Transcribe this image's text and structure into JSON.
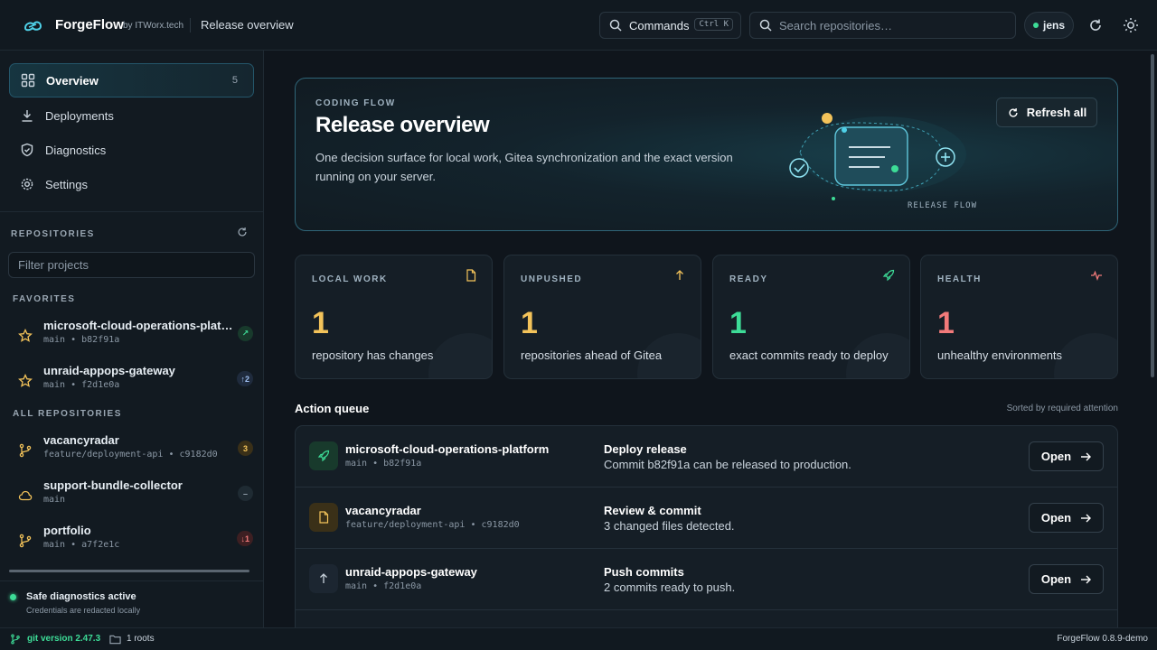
{
  "colors": {
    "accent": "#4fd1e8",
    "green": "#3ddc97",
    "yellow": "#f3c35a",
    "red": "#f27a7a",
    "blue": "#7aa7f2"
  },
  "topbar": {
    "brand": "ForgeFlow",
    "brand_by": "by ITWorx.tech",
    "page_title": "Release overview",
    "commands_label": "Commands",
    "commands_shortcut": "Ctrl K",
    "search_placeholder": "Search repositories…",
    "user": "jens"
  },
  "sidebar": {
    "nav": [
      {
        "label": "Overview",
        "count": "5",
        "icon": "grid-icon",
        "active": true
      },
      {
        "label": "Deployments",
        "icon": "download-icon"
      },
      {
        "label": "Diagnostics",
        "icon": "shield-icon"
      },
      {
        "label": "Settings",
        "icon": "gear-icon"
      }
    ],
    "repositories_label": "REPOSITORIES",
    "filter_placeholder": "Filter projects",
    "favorites_label": "FAVORITES",
    "all_label": "ALL REPOSITORIES",
    "favorites": [
      {
        "name": "microsoft-cloud-operations-platform",
        "meta": "main • b82f91a",
        "badge": "↗",
        "icon": "star-icon"
      },
      {
        "name": "unraid-appops-gateway",
        "meta": "main • f2d1e0a",
        "badge": "↑2",
        "icon": "star-icon"
      }
    ],
    "repos": [
      {
        "name": "vacancyradar",
        "meta": "feature/deployment-api • c9182d0",
        "badge": "3",
        "icon": "branch-icon"
      },
      {
        "name": "support-bundle-collector",
        "meta": "main",
        "badge": "–",
        "icon": "cloud-icon"
      },
      {
        "name": "portfolio",
        "meta": "main • a7f2e1c",
        "badge": "↓1",
        "icon": "branch-icon"
      }
    ],
    "diagnostics_title": "Safe diagnostics active",
    "diagnostics_sub": "Credentials are redacted locally"
  },
  "statusbar": {
    "git_version": "git version 2.47.3",
    "roots": "1 roots",
    "app_version": "ForgeFlow 0.8.9-demo"
  },
  "hero": {
    "eyebrow": "CODING FLOW",
    "title": "Release overview",
    "description": "One decision surface for local work, Gitea synchronization and the exact version running on your server.",
    "refresh_label": "Refresh all",
    "flow_label": "RELEASE FLOW"
  },
  "stats": [
    {
      "label": "LOCAL WORK",
      "value": "1",
      "desc": "repository has changes",
      "color": "#f3c35a",
      "icon": "file-icon"
    },
    {
      "label": "UNPUSHED",
      "value": "1",
      "desc": "repositories ahead of Gitea",
      "color": "#f3c35a",
      "icon": "arrow-up-icon"
    },
    {
      "label": "READY",
      "value": "1",
      "desc": "exact commits ready to deploy",
      "color": "#3ddc97",
      "icon": "rocket-icon"
    },
    {
      "label": "HEALTH",
      "value": "1",
      "desc": "unhealthy environments",
      "color": "#f27a7a",
      "icon": "pulse-icon"
    }
  ],
  "queue": {
    "title": "Action queue",
    "sort_label": "Sorted by required attention",
    "open_label": "Open",
    "rows": [
      {
        "repo": "microsoft-cloud-operations-platform",
        "meta": "main • b82f91a",
        "action": "Deploy release",
        "detail": "Commit b82f91a can be released to production.",
        "icon": "rocket-icon"
      },
      {
        "repo": "vacancyradar",
        "meta": "feature/deployment-api • c9182d0",
        "action": "Review & commit",
        "detail": "3 changed files detected.",
        "icon": "file-icon"
      },
      {
        "repo": "unraid-appops-gateway",
        "meta": "main • f2d1e0a",
        "action": "Push commits",
        "detail": "2 commits ready to push.",
        "icon": "arrow-up-icon"
      }
    ]
  }
}
